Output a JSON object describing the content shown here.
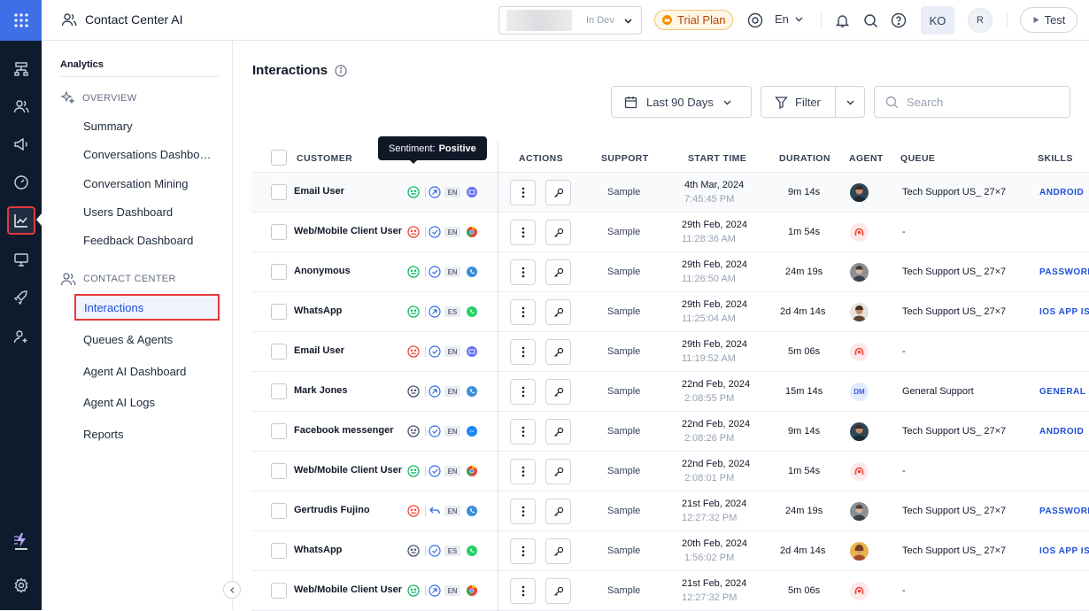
{
  "app": {
    "title": "Contact Center AI"
  },
  "topbar": {
    "env_label": "In Dev",
    "trial_label": "Trial Plan",
    "language": "En",
    "avatar_initials": "KO",
    "user_initial": "R",
    "test_label": "Test"
  },
  "sidebar": {
    "heading": "Analytics",
    "overview_label": "OVERVIEW",
    "overview_items": [
      {
        "label": "Summary"
      },
      {
        "label": "Conversations Dashboard"
      },
      {
        "label": "Conversation Mining"
      },
      {
        "label": "Users Dashboard"
      },
      {
        "label": "Feedback Dashboard"
      }
    ],
    "cc_label": "CONTACT CENTER",
    "cc_items": [
      {
        "label": "Interactions"
      },
      {
        "label": "Queues & Agents"
      },
      {
        "label": "Agent AI Dashboard"
      },
      {
        "label": "Agent AI Logs"
      },
      {
        "label": "Reports"
      }
    ]
  },
  "main": {
    "title": "Interactions",
    "date_range": "Last 90 Days",
    "filter_label": "Filter",
    "search_placeholder": "Search",
    "tooltip": {
      "prefix": "Sentiment:",
      "value": "Positive"
    },
    "columns": {
      "customer": "CUSTOMER",
      "actions": "ACTIONS",
      "support": "SUPPORT",
      "start_time": "START TIME",
      "duration": "DURATION",
      "agent": "AGENT",
      "queue": "QUEUE",
      "skills": "SKILLS"
    },
    "rows": [
      {
        "customer": "Email User",
        "sentiment": "positive",
        "direction": "outbound",
        "lang": "EN",
        "channel": "email",
        "support": "Sample",
        "date": "4th Mar, 2024",
        "time": "7:45:45 PM",
        "duration": "9m 14s",
        "agent": "photo-1",
        "agent_initials": "",
        "queue": "Tech Support US_ 27×7",
        "skill": "ANDROID"
      },
      {
        "customer": "Web/Mobile Client User",
        "sentiment": "negative",
        "direction": "resolved",
        "lang": "EN",
        "channel": "web",
        "support": "Sample",
        "date": "29th Feb, 2024",
        "time": "11:28:36 AM",
        "duration": "1m 54s",
        "agent": "bot",
        "agent_initials": "",
        "queue": "-",
        "skill": ""
      },
      {
        "customer": "Anonymous",
        "sentiment": "positive",
        "direction": "resolved",
        "lang": "EN",
        "channel": "voice",
        "support": "Sample",
        "date": "29th Feb, 2024",
        "time": "11:26:50 AM",
        "duration": "24m 19s",
        "agent": "photo-2",
        "agent_initials": "",
        "queue": "Tech Support US_ 27×7",
        "skill": "PASSWORD"
      },
      {
        "customer": "WhatsApp",
        "sentiment": "positive",
        "direction": "outbound",
        "lang": "ES",
        "channel": "whatsapp",
        "support": "Sample",
        "date": "29th Feb, 2024",
        "time": "11:25:04 AM",
        "duration": "2d 4m 14s",
        "agent": "photo-3",
        "agent_initials": "",
        "queue": "Tech Support US_ 27×7",
        "skill": "IOS  APP IS"
      },
      {
        "customer": "Email User",
        "sentiment": "negative",
        "direction": "resolved",
        "lang": "EN",
        "channel": "email",
        "support": "Sample",
        "date": "29th Feb, 2024",
        "time": "11:19:52 AM",
        "duration": "5m 06s",
        "agent": "bot",
        "agent_initials": "",
        "queue": "-",
        "skill": ""
      },
      {
        "customer": "Mark Jones",
        "sentiment": "neutral",
        "direction": "outbound",
        "lang": "EN",
        "channel": "voice",
        "support": "Sample",
        "date": "22nd Feb, 2024",
        "time": "2:08:55 PM",
        "duration": "15m 14s",
        "agent": "initials",
        "agent_initials": "DM",
        "queue": "General Support",
        "skill": "GENERAL S"
      },
      {
        "customer": "Facebook messenger",
        "sentiment": "neutral",
        "direction": "resolved",
        "lang": "EN",
        "channel": "messenger",
        "support": "Sample",
        "date": "22nd Feb, 2024",
        "time": "2:08:26 PM",
        "duration": "9m 14s",
        "agent": "photo-1",
        "agent_initials": "",
        "queue": "Tech Support US_ 27×7",
        "skill": "ANDROID"
      },
      {
        "customer": "Web/Mobile Client User",
        "sentiment": "positive",
        "direction": "resolved",
        "lang": "EN",
        "channel": "web",
        "support": "Sample",
        "date": "22nd Feb, 2024",
        "time": "2:08:01 PM",
        "duration": "1m 54s",
        "agent": "bot",
        "agent_initials": "",
        "queue": "-",
        "skill": ""
      },
      {
        "customer": "Gertrudis Fujino",
        "sentiment": "negative",
        "direction": "reply",
        "lang": "EN",
        "channel": "voice",
        "support": "Sample",
        "date": "21st Feb, 2024",
        "time": "12:27:32 PM",
        "duration": "24m 19s",
        "agent": "photo-2",
        "agent_initials": "",
        "queue": "Tech Support US_ 27×7",
        "skill": "PASSWORD"
      },
      {
        "customer": "WhatsApp",
        "sentiment": "neutral",
        "direction": "resolved",
        "lang": "ES",
        "channel": "whatsapp",
        "support": "Sample",
        "date": "20th Feb, 2024",
        "time": "1:56:02 PM",
        "duration": "2d 4m 14s",
        "agent": "photo-4",
        "agent_initials": "",
        "queue": "Tech Support US_ 27×7",
        "skill": "IOS  APP IS"
      },
      {
        "customer": "Web/Mobile Client User",
        "sentiment": "positive",
        "direction": "outbound",
        "lang": "EN",
        "channel": "web",
        "support": "Sample",
        "date": "21st Feb, 2024",
        "time": "12:27:32 PM",
        "duration": "5m 06s",
        "agent": "bot",
        "agent_initials": "",
        "queue": "-",
        "skill": ""
      }
    ]
  }
}
